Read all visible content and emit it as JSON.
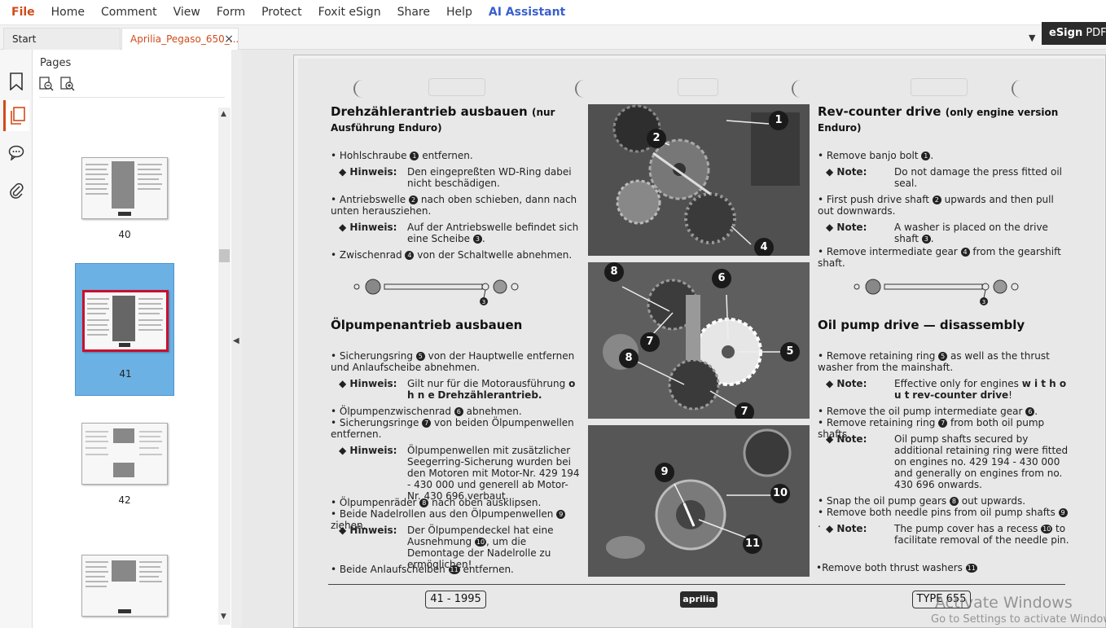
{
  "menu": {
    "items": [
      "File",
      "Home",
      "Comment",
      "View",
      "Form",
      "Protect",
      "Foxit eSign",
      "Share",
      "Help",
      "AI Assistant"
    ]
  },
  "tabs": {
    "start": "Start",
    "doc": "Aprilia_Pegaso_650_...",
    "close": "×"
  },
  "esign": {
    "bold": "eSign",
    "rest": " PDF E"
  },
  "sidebar": {
    "title": "Pages",
    "thumbs": [
      "40",
      "41",
      "42"
    ]
  },
  "doc": {
    "de_title_1": "Drehzählerantrieb ausbauen",
    "de_title_1_note": "(nur Ausführung Enduro)",
    "de_b1": "Hohlschraube",
    "de_b1_tail": "entfernen.",
    "hinweis": "◆ Hinweis:",
    "de_n1": "Den eingepreßten WD-Ring dabei nicht beschädigen.",
    "de_b2": "Antriebswelle",
    "de_b2_tail": "nach oben schieben, dann nach unten herausziehen.",
    "de_n2": "Auf der Antriebswelle befindet sich eine Scheibe",
    "de_b3": "Zwischenrad",
    "de_b3_tail": "von der Schaltwelle abnehmen.",
    "de_title_2": "Ölpumpenantrieb ausbauen",
    "de_b4": "Sicherungsring",
    "de_b4_tail": "von der Hauptwelle entfernen und Anlaufscheibe abnehmen.",
    "de_n4a": "Gilt nur für die Motorausführung",
    "de_n4b": "o h n e",
    "de_n4c": "Drehzählerantrieb.",
    "de_b5": "Ölpumpenzwischenrad",
    "de_b5_tail": "abnehmen.",
    "de_b6": "Sicherungsringe",
    "de_b6_tail": "von beiden Ölpumpenwellen entfernen.",
    "de_n6": "Ölpumpenwellen mit zusätzlicher Seegerring-Sicherung wurden bei den Motoren mit Motor-Nr. 429 194 - 430 000 und generell ab Motor-Nr. 430 696 verbaut.",
    "de_b7": "Ölpumpenräder",
    "de_b7_tail": "nach oben ausklipsen.",
    "de_b8": "Beide Nadelrollen aus den Ölpumpenwellen",
    "de_b8_tail": "ziehen.",
    "de_n8a": "Der Ölpumpendeckel hat eine Ausnehmung",
    "de_n8b": ", um die Demontage der Nadelrolle zu ermöglichen!",
    "de_b9": "Beide Anlaufscheiben",
    "de_b9_tail": "entfernen.",
    "en_title_1": "Rev-counter drive",
    "en_title_1_note": "(only engine version Enduro)",
    "en_b1": "Remove banjo bolt",
    "note": "◆ Note:",
    "en_n1": "Do not damage the press fitted oil seal.",
    "en_b2": "First push drive shaft",
    "en_b2_tail": "upwards and then pull out downwards.",
    "en_n2": "A washer is placed on the drive shaft",
    "en_b3": "Remove intermediate gear",
    "en_b3_tail": "from the gearshift shaft.",
    "en_title_2": "Oil pump drive — disassembly",
    "en_b4": "Remove retaining ring",
    "en_b4_tail": "as well as the thrust washer from the mainshaft.",
    "en_n4a": "Effective only for engines",
    "en_n4b": "w i t h o u t",
    "en_n4c": "rev-counter drive",
    "en_b5": "Remove the oil pump intermediate gear",
    "en_b6": "Remove retaining ring",
    "en_b6_tail": "from both oil pump shafts.",
    "en_n6": "Oil pump shafts secured by additional retaining ring were fitted on engines no. 429 194 - 430 000 and generally on engines from no. 430 696 onwards.",
    "en_b7": "Snap the oil pump gears",
    "en_b7_tail": "out upwards.",
    "en_b8": "Remove both needle pins from oil pump shafts",
    "en_n8a": "The pump cover has a recess",
    "en_n8b": "to facilitate removal of the needle pin.",
    "en_b9": "•Remove both thrust washers",
    "footer_left": "41 - 1995",
    "footer_logo": "aprilia",
    "footer_right": "TYPE 655",
    "callouts": [
      "1",
      "2",
      "3",
      "4",
      "5",
      "6",
      "7",
      "8",
      "9",
      "10",
      "11"
    ]
  },
  "watermark": {
    "line1": "Activate Windows",
    "line2": "Go to Settings to activate Windows."
  }
}
